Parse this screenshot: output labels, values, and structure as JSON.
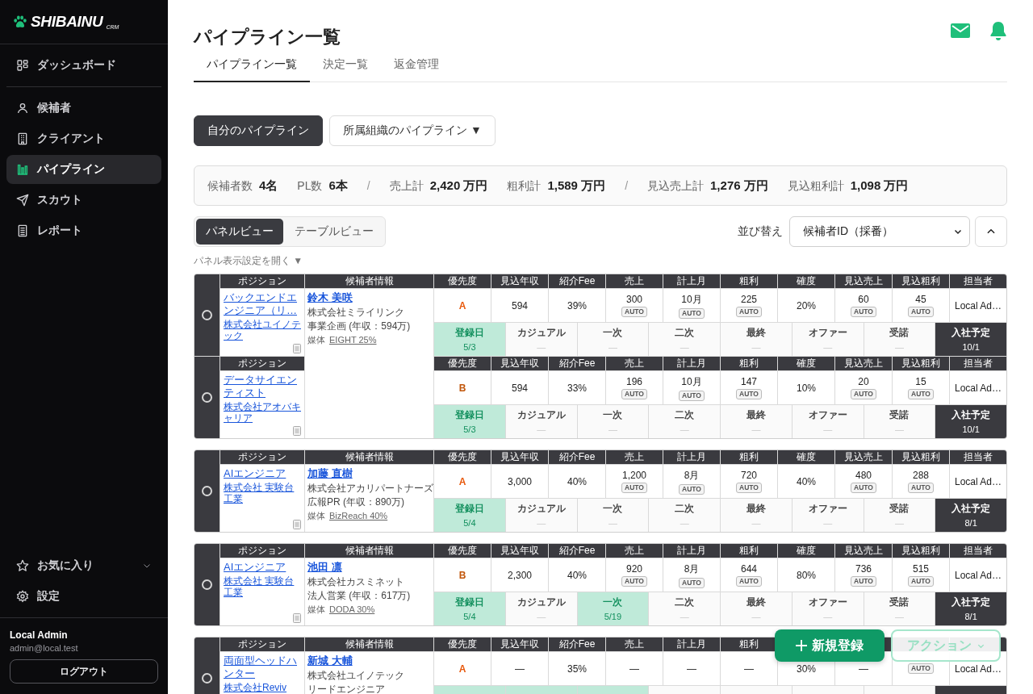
{
  "sidebar": {
    "logo": {
      "name": "SHIBAINU",
      "tag": "CRM"
    },
    "nav_top": [
      {
        "label": "ダッシュボード",
        "kind": "dashboard",
        "selected": false
      }
    ],
    "nav_main": [
      {
        "label": "候補者",
        "kind": "person",
        "selected": false
      },
      {
        "label": "クライアント",
        "kind": "building",
        "selected": false
      },
      {
        "label": "パイプライン",
        "kind": "bars",
        "selected": true
      },
      {
        "label": "スカウト",
        "kind": "send",
        "selected": false
      },
      {
        "label": "レポート",
        "kind": "report",
        "selected": false
      }
    ],
    "nav_bottom": [
      {
        "label": "お気に入り",
        "kind": "star",
        "selected": false,
        "expanded": false
      },
      {
        "label": "設定",
        "kind": "gear",
        "selected": false
      }
    ],
    "user": {
      "name": "Local Admin",
      "email": "admin@local.test"
    },
    "logout": "ログアウト"
  },
  "header": {
    "title": "パイプライン一覧",
    "tabs": [
      {
        "label": "パイプライン一覧",
        "selected": true
      },
      {
        "label": "決定一覧",
        "selected": false
      },
      {
        "label": "返金管理",
        "selected": false
      }
    ]
  },
  "scope": [
    {
      "label": "自分のパイプライン",
      "selected": true
    },
    {
      "label": "所属組織のパイプライン ▼",
      "selected": false
    }
  ],
  "summary": [
    {
      "kind": "stat",
      "label": "候補者数",
      "value": "4名"
    },
    {
      "kind": "stat",
      "label": "PL数",
      "value": "6本"
    },
    {
      "kind": "sep",
      "text": "/"
    },
    {
      "kind": "stat",
      "label": "売上計",
      "value": "2,420 万円"
    },
    {
      "kind": "stat",
      "label": "粗利計",
      "value": "1,589 万円"
    },
    {
      "kind": "sep",
      "text": "/"
    },
    {
      "kind": "stat",
      "label": "見込売上計",
      "value": "1,276 万円"
    },
    {
      "kind": "stat",
      "label": "見込粗利計",
      "value": "1,098 万円"
    }
  ],
  "views": [
    {
      "label": "パネルビュー",
      "selected": true
    },
    {
      "label": "テーブルビュー",
      "selected": false
    }
  ],
  "sort": {
    "label": "並び替え",
    "value": "候補者ID（採番）"
  },
  "panel_settings": "パネル表示設定を開く ▼",
  "cards": [
    {
      "candidate_header": "候補者情報",
      "candidate": {
        "name": "鈴木 美咲",
        "company": "株式会社ミライリンク",
        "role": "事業企画 (年収：594万)",
        "media_label": "媒体",
        "media": "EIGHT 25%"
      },
      "pipelines": [
        {
          "selected": false,
          "position_header": "ポジション",
          "position": "バックエンドエンジニア（リ…",
          "client": "株式会社ユイノテック",
          "metrics": [
            {
              "header": "優先度",
              "value": "A",
              "color": "#e8590c"
            },
            {
              "header": "見込年収",
              "value": "594"
            },
            {
              "header": "紹介Fee",
              "value": "39%"
            },
            {
              "header": "売上",
              "value": "300",
              "badge": "AUTO"
            },
            {
              "header": "計上月",
              "value": "10月",
              "badge": "AUTO"
            },
            {
              "header": "粗利",
              "value": "225",
              "badge": "AUTO"
            },
            {
              "header": "確度",
              "value": "20%"
            },
            {
              "header": "見込売上",
              "value": "60",
              "badge": "AUTO"
            },
            {
              "header": "見込粗利",
              "value": "45",
              "badge": "AUTO"
            },
            {
              "header": "担当者",
              "value": "Local Ad…"
            }
          ],
          "stages": [
            {
              "kind": "stage",
              "label": "登録日",
              "date": "5/3",
              "done": true
            },
            {
              "kind": "stage",
              "label": "カジュアル",
              "date": "—",
              "done": false
            },
            {
              "kind": "stage",
              "label": "一次",
              "date": "—",
              "done": false
            },
            {
              "kind": "stage",
              "label": "二次",
              "date": "—",
              "done": false
            },
            {
              "kind": "stage",
              "label": "最終",
              "date": "—",
              "done": false
            },
            {
              "kind": "stage",
              "label": "オファー",
              "date": "—",
              "done": false
            },
            {
              "kind": "stage",
              "label": "受諾",
              "date": "—",
              "done": false
            },
            {
              "kind": "join",
              "label": "入社予定",
              "date": "10/1"
            }
          ]
        },
        {
          "selected": false,
          "position_header": "ポジション",
          "position": "データサイエンティスト",
          "client": "株式会社アオバキャリア",
          "metrics": [
            {
              "header": "優先度",
              "value": "B",
              "color": "#c2570c"
            },
            {
              "header": "見込年収",
              "value": "594"
            },
            {
              "header": "紹介Fee",
              "value": "33%"
            },
            {
              "header": "売上",
              "value": "196",
              "badge": "AUTO"
            },
            {
              "header": "計上月",
              "value": "10月",
              "badge": "AUTO"
            },
            {
              "header": "粗利",
              "value": "147",
              "badge": "AUTO"
            },
            {
              "header": "確度",
              "value": "10%"
            },
            {
              "header": "見込売上",
              "value": "20",
              "badge": "AUTO"
            },
            {
              "header": "見込粗利",
              "value": "15",
              "badge": "AUTO"
            },
            {
              "header": "担当者",
              "value": "Local Ad…"
            }
          ],
          "stages": [
            {
              "kind": "stage",
              "label": "登録日",
              "date": "5/3",
              "done": true
            },
            {
              "kind": "stage",
              "label": "カジュアル",
              "date": "—",
              "done": false
            },
            {
              "kind": "stage",
              "label": "一次",
              "date": "—",
              "done": false
            },
            {
              "kind": "stage",
              "label": "二次",
              "date": "—",
              "done": false
            },
            {
              "kind": "stage",
              "label": "最終",
              "date": "—",
              "done": false
            },
            {
              "kind": "stage",
              "label": "オファー",
              "date": "—",
              "done": false
            },
            {
              "kind": "stage",
              "label": "受諾",
              "date": "—",
              "done": false
            },
            {
              "kind": "join",
              "label": "入社予定",
              "date": "10/1"
            }
          ]
        }
      ]
    },
    {
      "candidate_header": "候補者情報",
      "candidate": {
        "name": "加藤 直樹",
        "company": "株式会社アカリパートナーズ",
        "role": "広報PR (年収：890万)",
        "media_label": "媒体",
        "media": "BizReach 40%"
      },
      "pipelines": [
        {
          "selected": false,
          "position_header": "ポジション",
          "position": "AIエンジニア",
          "client": "株式会社 実験台工業",
          "metrics": [
            {
              "header": "優先度",
              "value": "A",
              "color": "#e8590c"
            },
            {
              "header": "見込年収",
              "value": "3,000"
            },
            {
              "header": "紹介Fee",
              "value": "40%"
            },
            {
              "header": "売上",
              "value": "1,200",
              "badge": "AUTO"
            },
            {
              "header": "計上月",
              "value": "8月",
              "badge": "AUTO"
            },
            {
              "header": "粗利",
              "value": "720",
              "badge": "AUTO"
            },
            {
              "header": "確度",
              "value": "40%"
            },
            {
              "header": "見込売上",
              "value": "480",
              "badge": "AUTO"
            },
            {
              "header": "見込粗利",
              "value": "288",
              "badge": "AUTO"
            },
            {
              "header": "担当者",
              "value": "Local Ad…"
            }
          ],
          "stages": [
            {
              "kind": "stage",
              "label": "登録日",
              "date": "5/4",
              "done": true
            },
            {
              "kind": "stage",
              "label": "カジュアル",
              "date": "—",
              "done": false
            },
            {
              "kind": "stage",
              "label": "一次",
              "date": "—",
              "done": false
            },
            {
              "kind": "stage",
              "label": "二次",
              "date": "—",
              "done": false
            },
            {
              "kind": "stage",
              "label": "最終",
              "date": "—",
              "done": false
            },
            {
              "kind": "stage",
              "label": "オファー",
              "date": "—",
              "done": false
            },
            {
              "kind": "stage",
              "label": "受諾",
              "date": "—",
              "done": false
            },
            {
              "kind": "join",
              "label": "入社予定",
              "date": "8/1"
            }
          ]
        }
      ]
    },
    {
      "candidate_header": "候補者情報",
      "candidate": {
        "name": "池田 凛",
        "company": "株式会社カスミネット",
        "role": "法人営業 (年収：617万)",
        "media_label": "媒体",
        "media": "DODA 30%"
      },
      "pipelines": [
        {
          "selected": false,
          "position_header": "ポジション",
          "position": "AIエンジニア",
          "client": "株式会社 実験台工業",
          "metrics": [
            {
              "header": "優先度",
              "value": "B",
              "color": "#c2570c"
            },
            {
              "header": "見込年収",
              "value": "2,300"
            },
            {
              "header": "紹介Fee",
              "value": "40%"
            },
            {
              "header": "売上",
              "value": "920",
              "badge": "AUTO"
            },
            {
              "header": "計上月",
              "value": "8月",
              "badge": "AUTO"
            },
            {
              "header": "粗利",
              "value": "644",
              "badge": "AUTO"
            },
            {
              "header": "確度",
              "value": "80%"
            },
            {
              "header": "見込売上",
              "value": "736",
              "badge": "AUTO"
            },
            {
              "header": "見込粗利",
              "value": "515",
              "badge": "AUTO"
            },
            {
              "header": "担当者",
              "value": "Local Ad…"
            }
          ],
          "stages": [
            {
              "kind": "stage",
              "label": "登録日",
              "date": "5/4",
              "done": true
            },
            {
              "kind": "stage",
              "label": "カジュアル",
              "date": "—",
              "done": false
            },
            {
              "kind": "stage",
              "label": "一次",
              "date": "5/19",
              "done": true
            },
            {
              "kind": "stage",
              "label": "二次",
              "date": "—",
              "done": false
            },
            {
              "kind": "stage",
              "label": "最終",
              "date": "—",
              "done": false
            },
            {
              "kind": "stage",
              "label": "オファー",
              "date": "—",
              "done": false
            },
            {
              "kind": "stage",
              "label": "受諾",
              "date": "—",
              "done": false
            },
            {
              "kind": "join",
              "label": "入社予定",
              "date": "8/1"
            }
          ]
        }
      ]
    },
    {
      "candidate_header": "候補者情報",
      "candidate": {
        "name": "新城 大輔",
        "company": "株式会社ユイノテック",
        "role": "リードエンジニア"
      },
      "pipelines": [
        {
          "selected": false,
          "position_header": "ポジション",
          "position": "両面型ヘッドハンター",
          "client": "株式会社Reviv",
          "metrics": [
            {
              "header": "優先度",
              "value": "A",
              "color": "#e8590c"
            },
            {
              "header": "見込年収",
              "value": "—"
            },
            {
              "header": "紹介Fee",
              "value": "35%"
            },
            {
              "header": "売上",
              "value": "—"
            },
            {
              "header": "計上月",
              "value": "—"
            },
            {
              "header": "粗利",
              "value": "—"
            },
            {
              "value": "30%"
            },
            {
              "value": "—"
            },
            {
              "badge": "AUTO"
            },
            {
              "value": "Local Ad…"
            }
          ],
          "stages": [
            {
              "kind": "stage",
              "done": true
            },
            {
              "kind": "stage",
              "done": true
            },
            {
              "kind": "stage",
              "done": true
            },
            {
              "kind": "stage",
              "done": false
            },
            {
              "kind": "stage",
              "done": false
            },
            {
              "kind": "stage",
              "done": false
            },
            {
              "kind": "stage",
              "done": false
            },
            {
              "kind": "join"
            }
          ]
        }
      ]
    }
  ],
  "actions": {
    "create": "新規登録",
    "menu": "アクション"
  }
}
